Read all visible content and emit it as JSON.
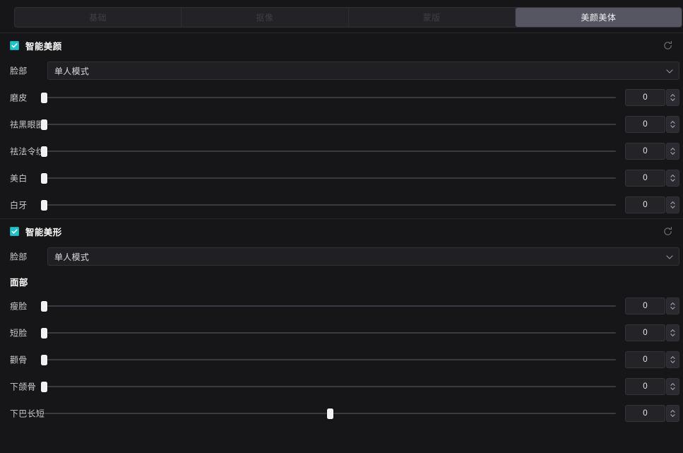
{
  "tabs": [
    {
      "label": "基础",
      "active": false,
      "name": "tab-basic"
    },
    {
      "label": "抠像",
      "active": false,
      "name": "tab-chromakey"
    },
    {
      "label": "蒙版",
      "active": false,
      "name": "tab-mask"
    },
    {
      "label": "美颜美体",
      "active": true,
      "name": "tab-beauty-body"
    }
  ],
  "colors": {
    "accent": "#21c3c8",
    "panel_bg": "#161618",
    "tab_active_bg": "#565663",
    "handle": "#f1f1f4"
  },
  "sections": [
    {
      "name": "smart-beauty",
      "title": "智能美颜",
      "checked": true,
      "reset_icon": "reset-icon",
      "mode_row": {
        "label": "脸部",
        "value": "单人模式",
        "caret_icon": "chevron-down-icon"
      },
      "sliders": [
        {
          "name": "skin-smoothing",
          "label": "磨皮",
          "value": "0",
          "pos": 0
        },
        {
          "name": "dark-circles",
          "label": "祛黑眼圈",
          "value": "0",
          "pos": 0
        },
        {
          "name": "nasolabial",
          "label": "祛法令纹",
          "value": "0",
          "pos": 0
        },
        {
          "name": "whitening",
          "label": "美白",
          "value": "0",
          "pos": 0
        },
        {
          "name": "teeth-whitening",
          "label": "白牙",
          "value": "0",
          "pos": 0
        }
      ]
    },
    {
      "name": "smart-reshape",
      "title": "智能美形",
      "checked": true,
      "reset_icon": "reset-icon",
      "mode_row": {
        "label": "脸部",
        "value": "单人模式",
        "caret_icon": "chevron-down-icon"
      },
      "subgroup": "面部",
      "sliders": [
        {
          "name": "face-slimming",
          "label": "瘦脸",
          "value": "0",
          "pos": 0
        },
        {
          "name": "short-face",
          "label": "短脸",
          "value": "0",
          "pos": 0
        },
        {
          "name": "cheekbone",
          "label": "颧骨",
          "value": "0",
          "pos": 0
        },
        {
          "name": "jawbone",
          "label": "下颌骨",
          "value": "0",
          "pos": 0
        },
        {
          "name": "chin-length",
          "label": "下巴长短",
          "value": "0",
          "pos": 50
        }
      ]
    }
  ]
}
